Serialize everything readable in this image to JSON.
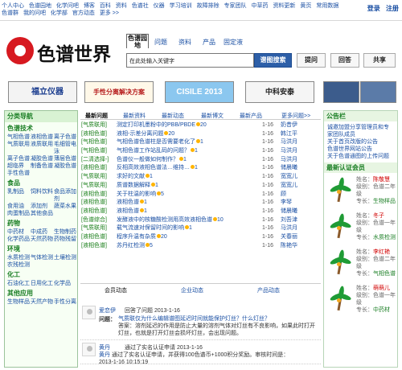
{
  "top_links": [
    "个人中心",
    "色谱园地",
    "化学问吧",
    "博客",
    "百科",
    "资料",
    "色谱社",
    "仪器",
    "学习培训",
    "故障排除",
    "专家团队",
    "中草药",
    "资料更新",
    "黄页",
    "常用数据",
    "色谱群",
    "我的问吧",
    "化学部",
    "官方动态",
    "更多 >>"
  ],
  "auth": {
    "login": "登录",
    "register": "注册"
  },
  "brand": {
    "logo_text": "色谱世界"
  },
  "search": {
    "tabs": [
      "色谱园地",
      "问题",
      "资料",
      "产品",
      "固定液"
    ],
    "placeholder": "在此处输入关键字",
    "button": "谱图搜索",
    "quick": [
      "提问",
      "回答",
      "共享"
    ]
  },
  "banners": [
    "福立仪器",
    "手性分离解决方案",
    "CISILE 2013",
    "中科安泰",
    "",
    ""
  ],
  "sidebar": {
    "title": "分类导航",
    "sections": [
      {
        "title": "色谱技术",
        "items": [
          "气相色谱",
          "液相色谱",
          "离子色谱",
          "气质联用",
          "液质联用",
          "毛细管电泳",
          "离子色谱",
          "凝胶色谱",
          "薄层色谱",
          "超临界",
          "制备色谱",
          "凝胶色谱",
          "手性色谱",
          "",
          ""
        ]
      },
      {
        "title": "食品",
        "items": [
          "乳制品",
          "饲料饮料",
          "食品添加剂",
          "食用油",
          "添加剂",
          "蔬菜水果",
          "肉蛋制品",
          "其他食品",
          ""
        ]
      },
      {
        "title": "药物",
        "items": [
          "中药材",
          "中成药",
          "生物制药",
          "化学药品",
          "天然药物",
          "药物残留"
        ]
      },
      {
        "title": "环境",
        "items": [
          "水质检测",
          "气体检测",
          "土壤检测",
          "农残检测",
          "",
          ""
        ]
      },
      {
        "title": "化工",
        "items": [
          "石油化工",
          "日用化工",
          "化学品"
        ]
      },
      {
        "title": "其他应用",
        "items": [
          "生物样品",
          "天然产物",
          "手性分离"
        ]
      }
    ]
  },
  "main_tabs": [
    "最新问题",
    "最新资料",
    "最新动态",
    "最新博文",
    "最新产品",
    "更多问题>>"
  ],
  "questions": [
    {
      "tag": "[气质联用]",
      "title": "测定打印机墨粉中的PBB/PBDE",
      "coins": "20",
      "date": "1-16",
      "user": "奶昔伊"
    },
    {
      "tag": "[液相色谱]",
      "title": "液相-示差分离问题",
      "coins": "20",
      "date": "1-16",
      "user": "韩江平"
    },
    {
      "tag": "[气相色谱]",
      "title": "气相色谱色谱柱是否需要老化了",
      "coins": "1",
      "date": "1-16",
      "user": "马洪月"
    },
    {
      "tag": "[气相色谱]",
      "title": "气相色谱工作站乱码的问题？",
      "coins": "1",
      "date": "1-16",
      "user": "马洪月"
    },
    {
      "tag": "[二清选择-]",
      "title": "色谱仪一般做如何制作？",
      "coins": "1",
      "date": "1-16",
      "user": "马洪月"
    },
    {
      "tag": "[液相色谱]",
      "title": "反相高效液相色谱法…维持…",
      "coins": "1",
      "date": "1-16",
      "user": "储晨曦"
    },
    {
      "tag": "[气质联用]",
      "title": "求好的文献",
      "coins": "1",
      "date": "1-16",
      "user": "宽宽儿"
    },
    {
      "tag": "[气质联用]",
      "title": "质谱数据解释",
      "coins": "1",
      "date": "1-16",
      "user": "宽宽儿"
    },
    {
      "tag": "[液相色谱]",
      "title": "关于柱温的影响",
      "coins": "5",
      "date": "1-16",
      "user": "顾"
    },
    {
      "tag": "[液相色谱]",
      "title": "液相色谱",
      "coins": "1",
      "date": "1-16",
      "user": "李琴"
    },
    {
      "tag": "[液相色谱]",
      "title": "液相色谱",
      "coins": "1",
      "date": "1-16",
      "user": "储晨曦"
    },
    {
      "tag": "[色谱综合]",
      "title": "发酵液中的核糖酸检测用高效液相色谱",
      "coins": "10",
      "date": "1-16",
      "user": "刘吾津"
    },
    {
      "tag": "[气质联用]",
      "title": "载气流速对保留时间的影响",
      "coins": "1",
      "date": "1-16",
      "user": "马洪月"
    },
    {
      "tag": "[液相色谱]",
      "title": "程序升温有杂质",
      "coins": "20",
      "date": "1-16",
      "user": "关春丽"
    },
    {
      "tag": "[液相色谱]",
      "title": "苏丹红检测",
      "coins": "5",
      "date": "1-16",
      "user": "陈艳华"
    }
  ],
  "activity_tabs": [
    "会员动态",
    "企业动态",
    "产品动态"
  ],
  "feed": [
    {
      "name": "爱恋伊",
      "action": "回答了问题",
      "date": "2013-1-16",
      "label": "问题：",
      "body_link": "气质联仅为什么编辑谱图延迟时间就能保护灯丝？什么灯丝？",
      "answer_label": "答案：",
      "answer": "溶剂延迟的作用是防止大量的溶剂气体对灯丝有不良影响，如果此时打开灯丝，也就是打开灯丝会损坏灯丝，会出现问题。"
    },
    {
      "name": "黄丹",
      "action": "通过了实名认证申请",
      "date": "2013-1-16",
      "label": "",
      "body_link": "黄丹",
      "answer_label": "",
      "answer": "通过了实名认证申请，并获得100色谱币+1000积分奖励。审核时间是：2013-1-16 10:15:19"
    }
  ],
  "right": {
    "notice_title": "公告栏",
    "notices": [
      "诚邀加盟分享管理员和专家团队成员",
      "关于首页改版的公告",
      "色谱世界网站公告",
      "关于色谱通图的上传问题"
    ],
    "experts_title": "最新认证会员",
    "experts": [
      {
        "name": "陈敬慧",
        "level": "色谱二年级",
        "spec": "生物样品"
      },
      {
        "name": "冬子",
        "level": "色谱一年级",
        "spec": "水质检测"
      },
      {
        "name": "李红艳",
        "level": "色谱二年级",
        "spec": "气相色谱"
      },
      {
        "name": "萌萌儿",
        "level": "色谱一年级",
        "spec": "中药材"
      }
    ],
    "field_labels": {
      "name": "姓名：",
      "level": "级别：",
      "spec": "专长："
    }
  }
}
